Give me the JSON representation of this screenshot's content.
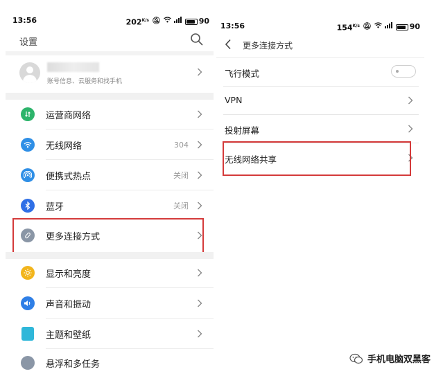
{
  "left": {
    "status": {
      "time": "13:56",
      "speed": "202",
      "speed_unit": "K/s",
      "battery": "90"
    },
    "title": "设置",
    "account": {
      "subtitle": "账号信息、云服务和找手机"
    },
    "items": [
      {
        "label": "运营商网络",
        "value": "",
        "icon": "sim-card-icon",
        "color": "#2db46b"
      },
      {
        "label": "无线网络",
        "value": "304",
        "icon": "wifi-icon",
        "color": "#2f8fe6"
      },
      {
        "label": "便携式热点",
        "value": "关闭",
        "icon": "hotspot-icon",
        "color": "#2f8fe6"
      },
      {
        "label": "蓝牙",
        "value": "关闭",
        "icon": "bluetooth-icon",
        "color": "#2f6fe6"
      },
      {
        "label": "更多连接方式",
        "value": "",
        "icon": "link-icon",
        "color": "#8a96a6"
      },
      {
        "label": "显示和亮度",
        "value": "",
        "icon": "brightness-icon",
        "color": "#f2b51c"
      },
      {
        "label": "声音和振动",
        "value": "",
        "icon": "sound-icon",
        "color": "#2f7fe6"
      },
      {
        "label": "主题和壁纸",
        "value": "",
        "icon": "theme-icon",
        "color": "#2fb7d9"
      },
      {
        "label": "悬浮和多任务",
        "value": "",
        "icon": "float-icon",
        "color": "#8a96a6"
      }
    ]
  },
  "right": {
    "status": {
      "time": "13:56",
      "speed": "154",
      "speed_unit": "K/s",
      "battery": "90"
    },
    "title": "更多连接方式",
    "items": [
      {
        "label": "飞行模式",
        "control": "toggle",
        "state": "off"
      },
      {
        "label": "VPN",
        "control": "chevron"
      },
      {
        "label": "投射屏幕",
        "control": "chevron"
      },
      {
        "label": "无线网络共享",
        "control": "chevron"
      }
    ]
  },
  "watermark": "手机电脑双黑客",
  "colors": {
    "highlight": "#d43a3a"
  }
}
